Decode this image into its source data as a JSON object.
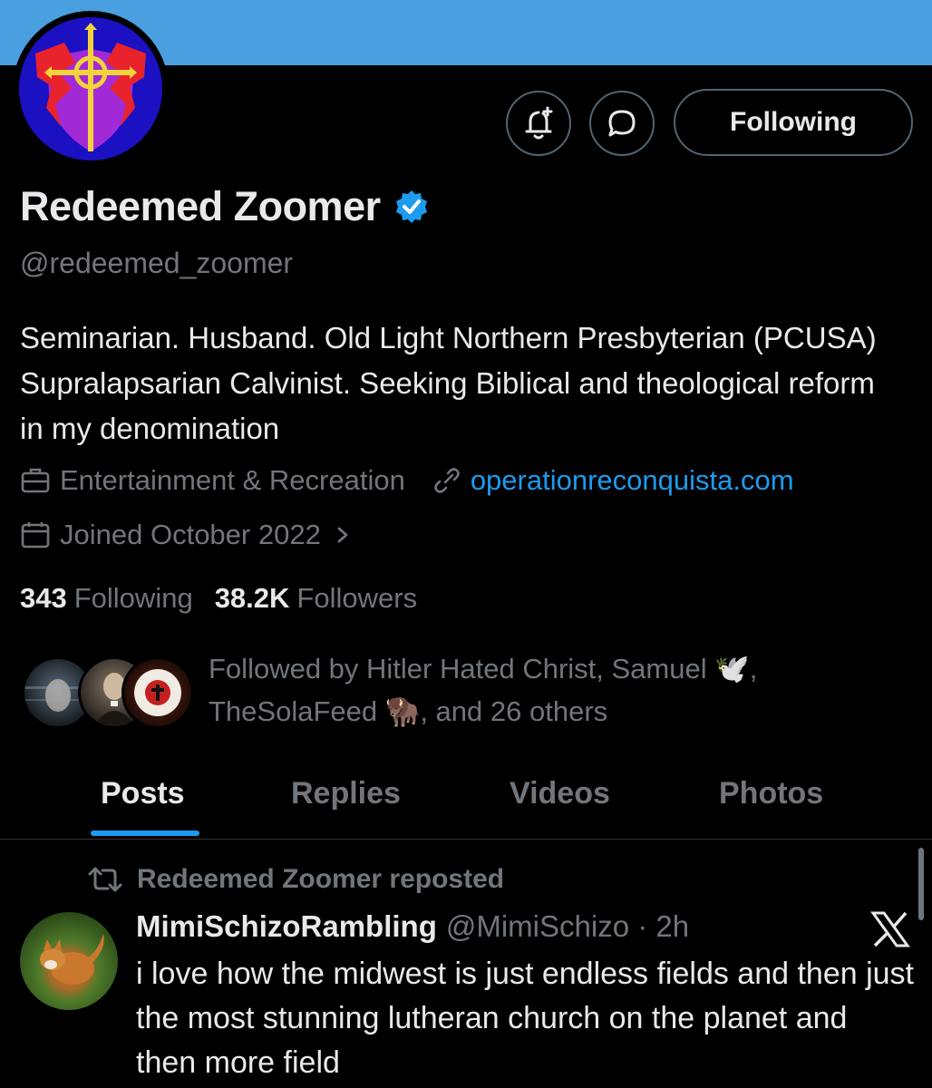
{
  "profile": {
    "display_name": "Redeemed Zoomer",
    "handle": "@redeemed_zoomer",
    "bio": "Seminarian. Husband. Old Light Northern Presbyterian (PCUSA) Supralapsarian Calvinist. Seeking Biblical and theological reform in my denomination",
    "category": "Entertainment & Recreation",
    "website": "operationreconquista.com",
    "joined": "Joined October 2022",
    "following_count": "343",
    "following_label": "Following",
    "followers_count": "38.2K",
    "followers_label": "Followers",
    "followed_by_line1": "Followed by Hitler Hated Christ, Samuel 🕊️,",
    "followed_by_line2": "TheSolaFeed 🦬, and 26 others"
  },
  "actions": {
    "following_button": "Following"
  },
  "tabs": [
    {
      "label": "Posts"
    },
    {
      "label": "Replies"
    },
    {
      "label": "Videos"
    },
    {
      "label": "Photos"
    }
  ],
  "post": {
    "repost_label": "Redeemed Zoomer reposted",
    "author_name": "MimiSchizoRambling",
    "author_handle_time": "@MimiSchizo · 2h",
    "text": "i love how the midwest is just endless fields and then just the most stunning lutheran church on the planet and then more field"
  },
  "colors": {
    "banner": "#4a9fe0",
    "accent": "#1d9bf0",
    "background": "#000000",
    "muted_text": "#71767b"
  },
  "icons": [
    "notification-plus-icon",
    "message-icon",
    "verified-badge-icon",
    "briefcase-icon",
    "link-icon",
    "calendar-icon",
    "chevron-right-icon",
    "repost-icon",
    "x-logo-icon"
  ]
}
